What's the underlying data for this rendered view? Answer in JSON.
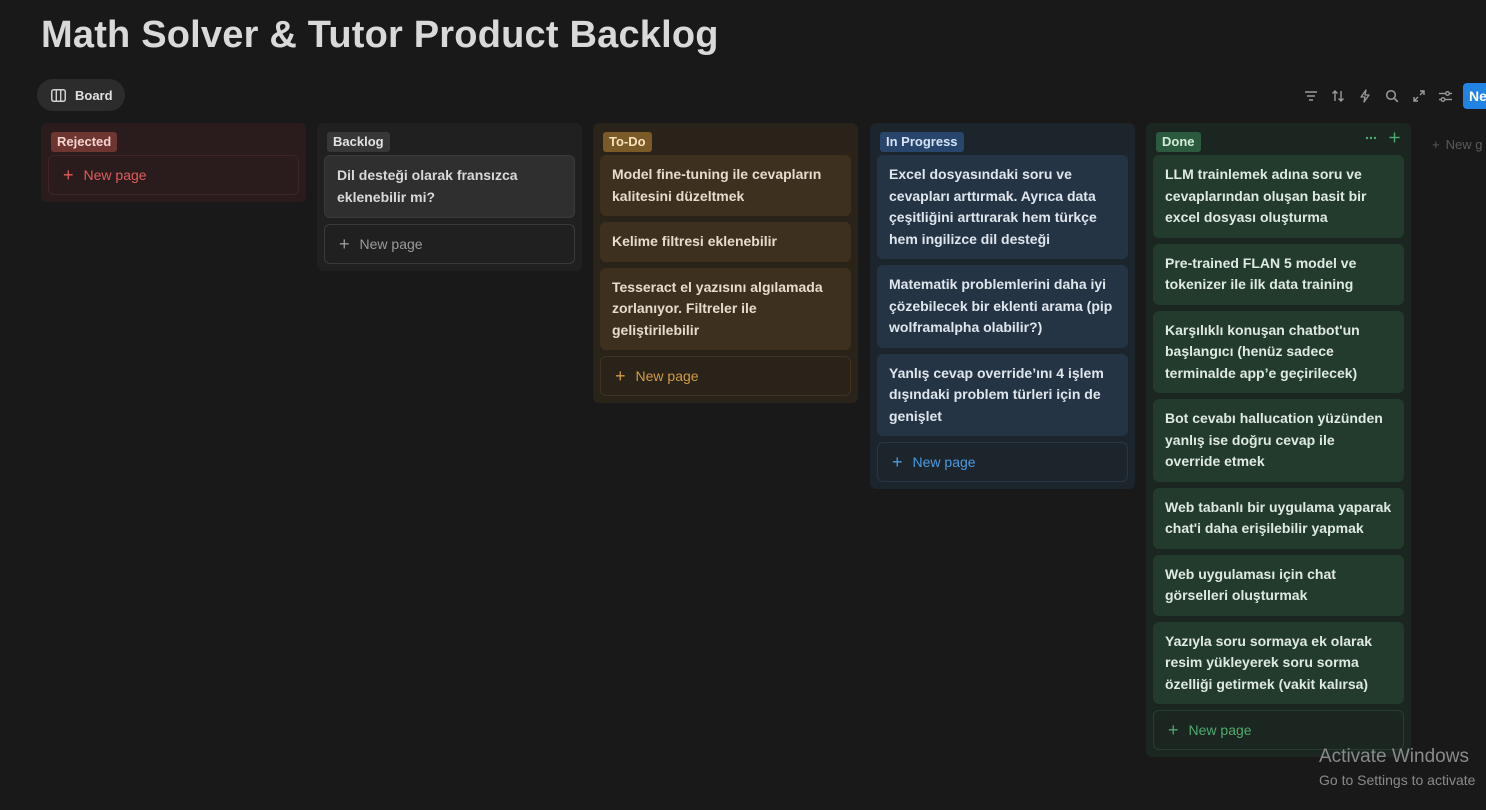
{
  "page": {
    "title": "Math Solver & Tutor Product Backlog"
  },
  "views": {
    "active_tab": {
      "label": "Board",
      "icon": "board-icon"
    }
  },
  "toolbar": {
    "icons": [
      "filter-icon",
      "sort-icon",
      "automation-bolt-icon",
      "search-icon",
      "expand-icon",
      "settings-sliders-icon"
    ],
    "new_button_label": "Ne"
  },
  "board": {
    "columns": [
      {
        "key": "rejected",
        "label": "Rejected",
        "color": "#6e3630",
        "cards": [],
        "new_page_label": "New page"
      },
      {
        "key": "backlog",
        "label": "Backlog",
        "color": "#373737",
        "cards": [
          "Dil desteği olarak fransızca eklenebilir mi?"
        ],
        "new_page_label": "New page"
      },
      {
        "key": "todo",
        "label": "To-Do",
        "color": "#7a5a26",
        "cards": [
          " Model fine-tuning ile cevapların kalitesini düzeltmek",
          "Kelime filtresi eklenebilir",
          "Tesseract el yazısını algılamada zorlanıyor. Filtreler ile geliştirilebilir"
        ],
        "new_page_label": "New page"
      },
      {
        "key": "in_progress",
        "label": "In Progress",
        "color": "#28456c",
        "cards": [
          " Excel dosyasındaki soru ve cevapları arttırmak. Ayrıca data çeşitliğini arttırarak hem türkçe hem ingilizce dil desteği",
          "Matematik problemlerini daha iyi çözebilecek bir eklenti arama (pip wolframalpha olabilir?)",
          "Yanlış cevap override’ını 4 işlem dışındaki problem türleri için de genişlet"
        ],
        "new_page_label": "New page"
      },
      {
        "key": "done",
        "label": "Done",
        "color": "#2b5a3e",
        "cards": [
          "LLM trainlemek adına soru ve cevaplarından oluşan basit bir excel dosyası oluşturma",
          "Pre-trained FLAN 5 model ve tokenizer ile ilk data training",
          "Karşılıklı konuşan chatbot'un başlangıcı (henüz sadece terminalde app’e geçirilecek)",
          "Bot cevabı hallucation yüzünden yanlış ise doğru cevap ile override etmek",
          "Web tabanlı bir uygulama yaparak chat'i daha erişilebilir yapmak",
          "Web uygulaması için chat görselleri oluşturmak",
          "Yazıyla soru sormaya ek olarak resim yükleyerek soru sorma özelliği getirmek (vakit kalırsa)"
        ],
        "new_page_label": "New page"
      }
    ],
    "new_group_label": "New g"
  },
  "watermark": {
    "title": "Activate Windows",
    "subtitle": "Go to Settings to activate"
  }
}
